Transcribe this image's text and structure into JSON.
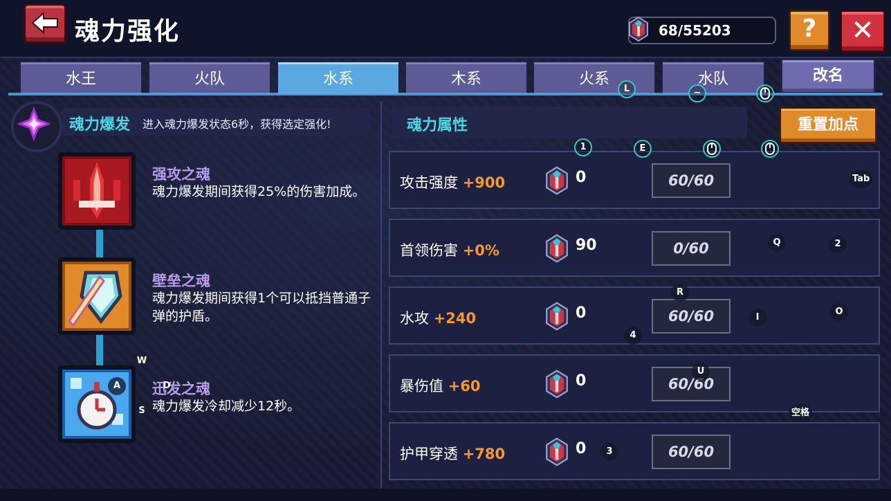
{
  "header": {
    "title": "魂力强化",
    "currency": "68/55203",
    "help_label": "?",
    "close_label": "✕"
  },
  "tabs": [
    {
      "label": "水王",
      "active": false
    },
    {
      "label": "火队",
      "active": false
    },
    {
      "label": "水系",
      "active": true
    },
    {
      "label": "木系",
      "active": false
    },
    {
      "label": "火系",
      "active": false
    },
    {
      "label": "水队",
      "active": false
    }
  ],
  "rename_label": "改名",
  "burst": {
    "title": "魂力爆发",
    "desc": "进入魂力爆发状态6秒，获得选定强化!"
  },
  "skills": [
    {
      "name": "强攻之魂",
      "desc": "魂力爆发期间获得25%的伤害加成。",
      "icon": "sword-soul-icon"
    },
    {
      "name": "壁垒之魂",
      "desc": "魂力爆发期间获得1个可以抵挡普通子弹的护盾。",
      "icon": "shield-soul-icon"
    },
    {
      "name": "迅发之魂",
      "desc": "魂力爆发冷却减少12秒。",
      "icon": "clock-soul-icon"
    }
  ],
  "attributes": {
    "title": "魂力属性",
    "reset_label": "重置加点",
    "rows": [
      {
        "name": "攻击强度",
        "bonus": "+900",
        "count": "0",
        "level": "60/60"
      },
      {
        "name": "首领伤害",
        "bonus": "+0%",
        "count": "90",
        "level": "0/60"
      },
      {
        "name": "水攻",
        "bonus": "+240",
        "count": "0",
        "level": "60/60"
      },
      {
        "name": "暴伤值",
        "bonus": "+60",
        "count": "0",
        "level": "60/60"
      },
      {
        "name": "护甲穿透",
        "bonus": "+780",
        "count": "0",
        "level": "60/60"
      }
    ]
  },
  "key_hints": {
    "L": "L",
    "tilde": "~",
    "one": "1",
    "E": "E",
    "tab": "Tab",
    "Q": "Q",
    "two": "2",
    "R": "R",
    "I": "I",
    "O": "O",
    "four": "4",
    "U": "U",
    "W": "W",
    "A": "A",
    "D": "D",
    "S": "S",
    "space": "空格",
    "three": "3"
  },
  "colors": {
    "accent_cyan": "#48d6e0",
    "bonus_orange": "#f59a2a",
    "tab_active": "#5ba7e2",
    "skill_name": "#b79ce8"
  }
}
